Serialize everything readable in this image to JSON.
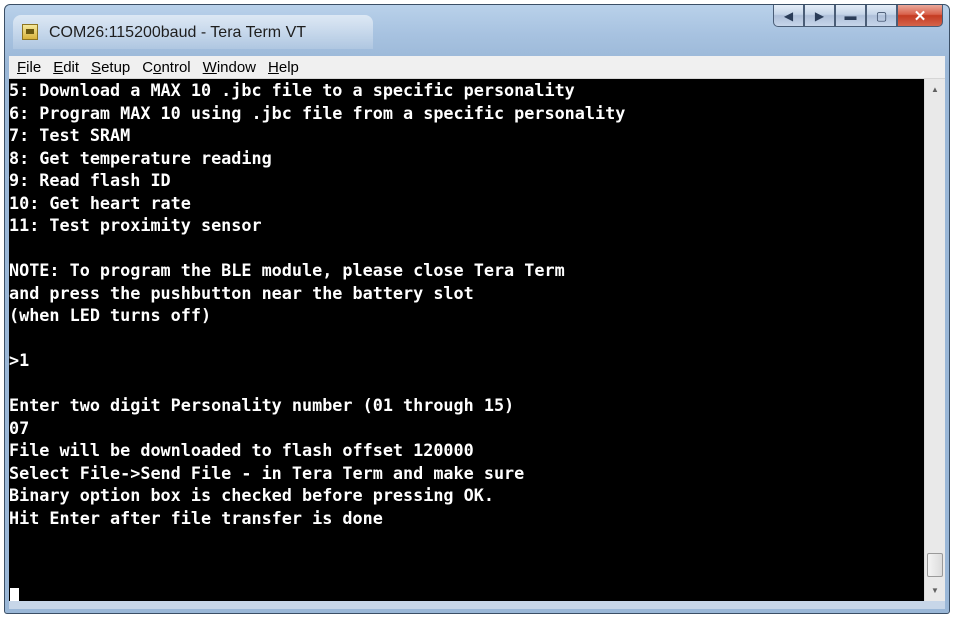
{
  "window": {
    "title": "COM26:115200baud - Tera Term VT",
    "app_icon": "tera-term-icon",
    "caption_buttons": [
      "back-icon",
      "forward-icon",
      "minimize-icon",
      "maximize-icon",
      "close-icon"
    ],
    "colors": {
      "frame": "#a7c2e0",
      "terminal_bg": "#000000",
      "terminal_text": "#ffffff",
      "close_button": "#c43b22"
    }
  },
  "menubar": {
    "items": [
      {
        "acc": "F",
        "rest": "ile"
      },
      {
        "acc": "E",
        "rest": "dit"
      },
      {
        "acc": "S",
        "rest": "etup"
      },
      {
        "pre": "C",
        "acc": "o",
        "rest": "ntrol"
      },
      {
        "acc": "W",
        "rest": "indow"
      },
      {
        "acc": "H",
        "rest": "elp"
      }
    ]
  },
  "terminal": {
    "lines": [
      "5: Download a MAX 10 .jbc file to a specific personality",
      "6: Program MAX 10 using .jbc file from a specific personality",
      "7: Test SRAM",
      "8: Get temperature reading",
      "9: Read flash ID",
      "10: Get heart rate",
      "11: Test proximity sensor",
      "",
      "NOTE: To program the BLE module, please close Tera Term",
      "and press the pushbutton near the battery slot",
      "(when LED turns off)",
      "",
      ">1",
      "",
      "Enter two digit Personality number (01 through 15)",
      "07",
      "File will be downloaded to flash offset 120000",
      "Select File->Send File - in Tera Term and make sure",
      "Binary option box is checked before pressing OK.",
      "Hit Enter after file transfer is done"
    ]
  },
  "scrollbar": {
    "up_icon": "scroll-up-arrow-icon",
    "down_icon": "scroll-down-arrow-icon",
    "position": 1.0
  }
}
